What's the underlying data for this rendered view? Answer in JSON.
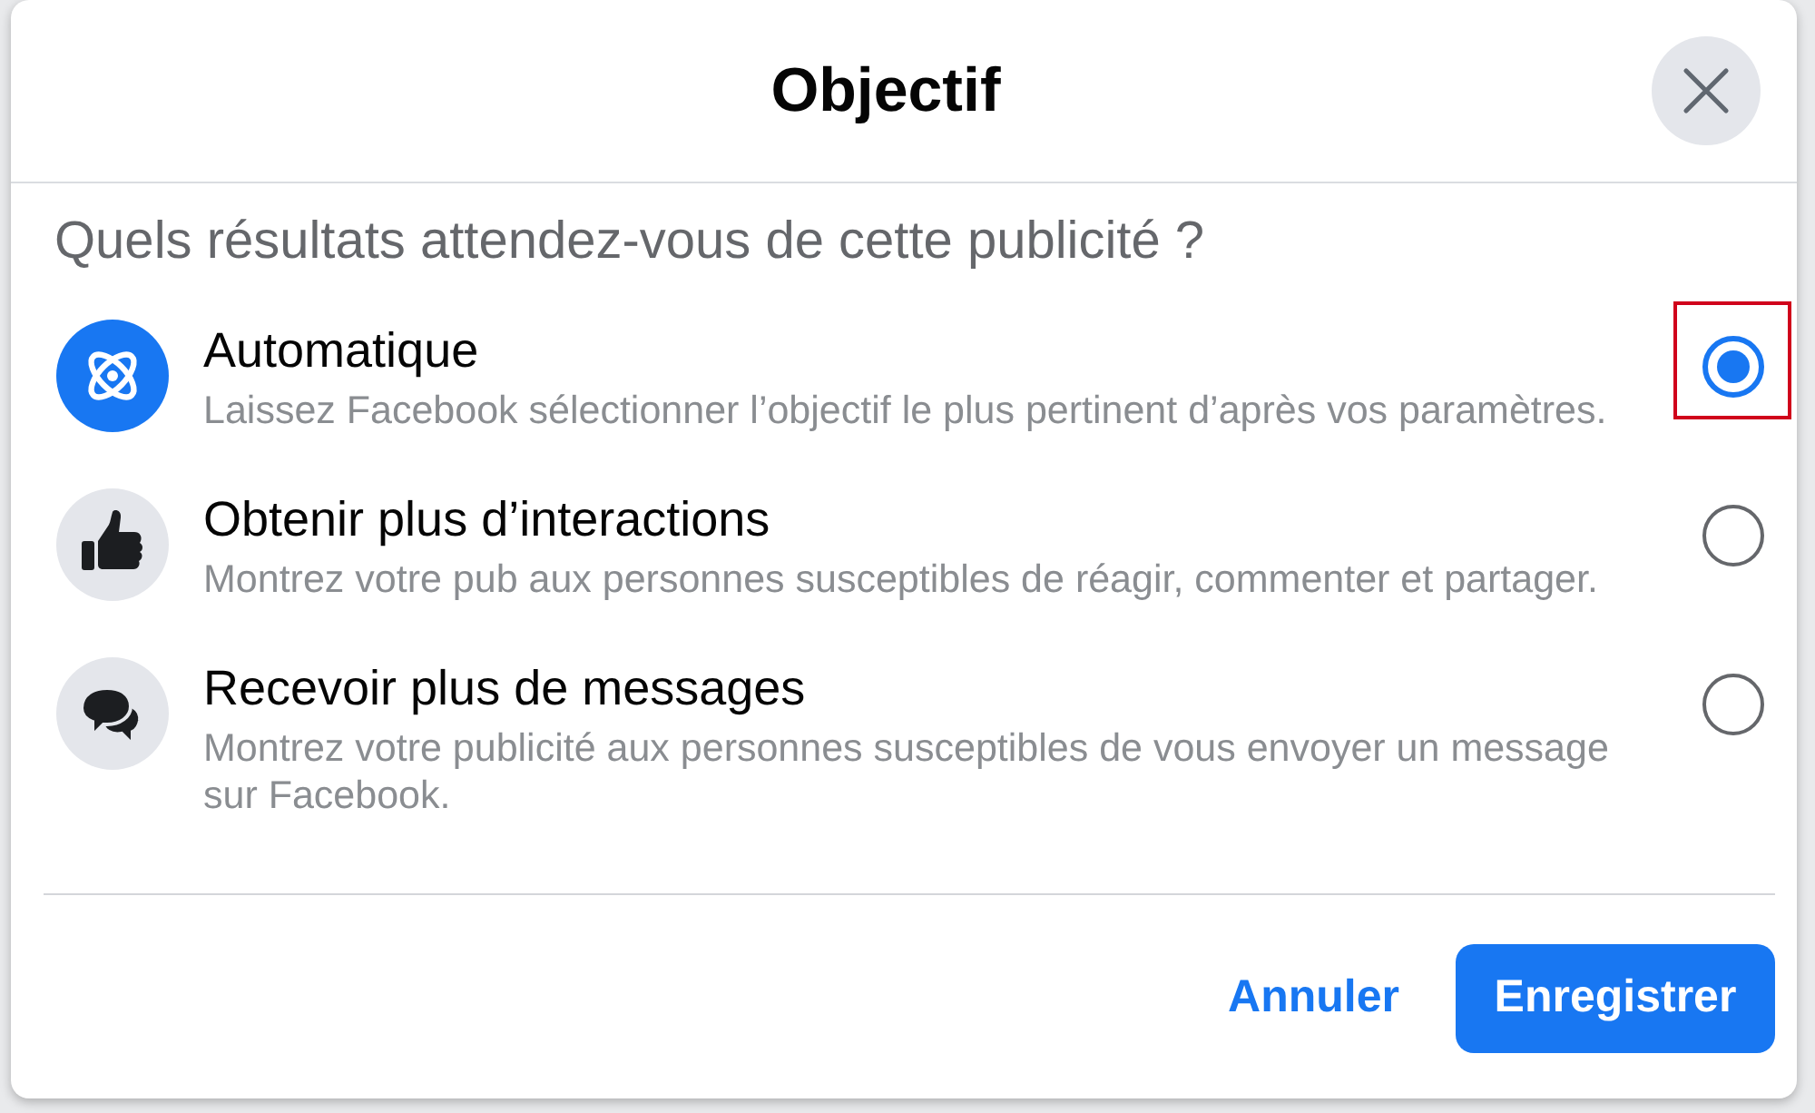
{
  "dialog": {
    "title": "Objectif",
    "question": "Quels résultats attendez-vous de cette publicité ?",
    "options": [
      {
        "kind": "atom",
        "title": "Automatique",
        "description": "Laissez Facebook sélectionner l’objectif le plus pertinent d’après vos paramètres.",
        "selected": true,
        "highlighted": true
      },
      {
        "kind": "thumbs-up",
        "title": "Obtenir plus d’interactions",
        "description": "Montrez votre pub aux personnes susceptibles de réagir, commenter et partager.",
        "selected": false,
        "highlighted": false
      },
      {
        "kind": "chat",
        "title": "Recevoir plus de messages",
        "description": "Montrez votre publicité aux personnes susceptibles de vous envoyer un message sur Facebook.",
        "selected": false,
        "highlighted": false
      }
    ],
    "buttons": [
      {
        "kind": "link",
        "label": "Annuler"
      },
      {
        "kind": "primary",
        "label": "Enregistrer"
      }
    ]
  }
}
